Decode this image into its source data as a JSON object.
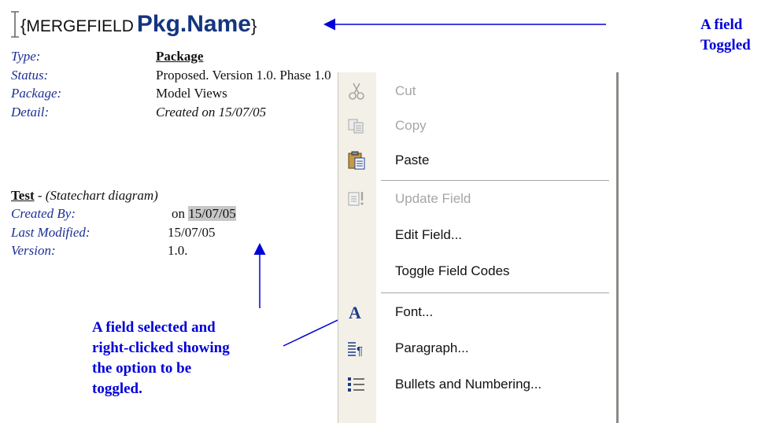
{
  "merge_field": {
    "open_brace": "{",
    "keyword": "MERGEFIELD",
    "name": "Pkg.Name",
    "close_brace": "}"
  },
  "doc": {
    "package_rows": [
      {
        "label": "Type:",
        "value": "Package"
      },
      {
        "label": "Status:",
        "value": "Proposed. Version 1.0. Phase 1.0"
      },
      {
        "label": "Package:",
        "value": "Model Views"
      },
      {
        "label": "Detail:",
        "value": "Created on 15/07/05"
      }
    ],
    "diagram_title": "Test",
    "diagram_subtitle": " - (Statechart diagram)",
    "diagram_rows": [
      {
        "label": "Created By:",
        "value_prefix": "on ",
        "value_highlight": "15/07/05"
      },
      {
        "label": "Last Modified:",
        "value": "15/07/05"
      },
      {
        "label": "Version:",
        "value": "1.0."
      }
    ]
  },
  "annotations": {
    "toggled_line1": "A field",
    "toggled_line2": "Toggled",
    "selected": [
      "A field selected and",
      "right-clicked showing",
      "the option to be",
      "toggled."
    ],
    "color": "#0000d8"
  },
  "context_menu": {
    "items": [
      {
        "label": "Cut",
        "icon": "scissors-icon",
        "enabled": false
      },
      {
        "label": "Copy",
        "icon": "copy-icon",
        "enabled": false
      },
      {
        "label": "Paste",
        "icon": "paste-icon",
        "enabled": true
      },
      {
        "label": "Update Field",
        "icon": "update-field-icon",
        "enabled": false
      },
      {
        "label": "Edit Field...",
        "icon": "",
        "enabled": true
      },
      {
        "label": "Toggle Field Codes",
        "icon": "",
        "enabled": true
      },
      {
        "label": "Font...",
        "icon": "font-icon",
        "enabled": true
      },
      {
        "label": "Paragraph...",
        "icon": "paragraph-icon",
        "enabled": true
      },
      {
        "label": "Bullets and Numbering...",
        "icon": "bullets-icon",
        "enabled": true
      }
    ]
  }
}
